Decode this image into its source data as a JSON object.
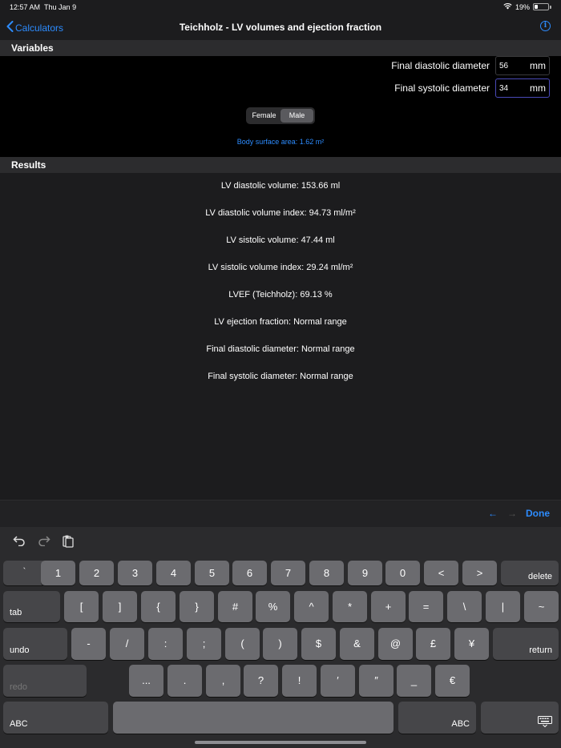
{
  "status": {
    "time": "12:57 AM",
    "date": "Thu Jan 9",
    "battery": "19%"
  },
  "nav": {
    "back_label": "Calculators",
    "title": "Teichholz - LV volumes and ejection fraction",
    "info_icon": "info-circle-icon"
  },
  "variables": {
    "header": "Variables",
    "fields": [
      {
        "label": "Final diastolic diameter",
        "value": "56",
        "unit": "mm"
      },
      {
        "label": "Final systolic diameter",
        "value": "34",
        "unit": "mm"
      }
    ],
    "sex_options": [
      "Female",
      "Male"
    ],
    "sex_selected": "Male",
    "bsa_text": "Body surface area: 1.62 m²"
  },
  "results": {
    "header": "Results",
    "lines": [
      "LV diastolic volume: 153.66 ml",
      "LV diastolic volume index: 94.73 ml/m²",
      "LV sistolic volume: 47.44 ml",
      "LV sistolic volume index: 29.24 ml/m²",
      "LVEF (Teichholz): 69.13 %",
      "LV ejection fraction: Normal range",
      "Final diastolic diameter: Normal range",
      "Final systolic diameter: Normal range"
    ]
  },
  "toolbar": {
    "prev": "←",
    "next": "→",
    "done": "Done"
  },
  "keyboard": {
    "row1": [
      "`",
      "1",
      "2",
      "3",
      "4",
      "5",
      "6",
      "7",
      "8",
      "9",
      "0",
      "<",
      ">"
    ],
    "delete": "delete",
    "tab": "tab",
    "row2": [
      "[",
      "]",
      "{",
      "}",
      "#",
      "%",
      "^",
      "*",
      "+",
      "=",
      "\\",
      "|",
      "~"
    ],
    "undo": "undo",
    "row3": [
      "-",
      "/",
      ":",
      ";",
      "(",
      ")",
      "$",
      "&",
      "@",
      "£",
      "¥"
    ],
    "return": "return",
    "redo": "redo",
    "row4": [
      "...",
      ".",
      ",",
      "?",
      "!",
      "′",
      "″",
      "_",
      "€"
    ],
    "abc_left": "ABC",
    "abc_right": "ABC"
  }
}
